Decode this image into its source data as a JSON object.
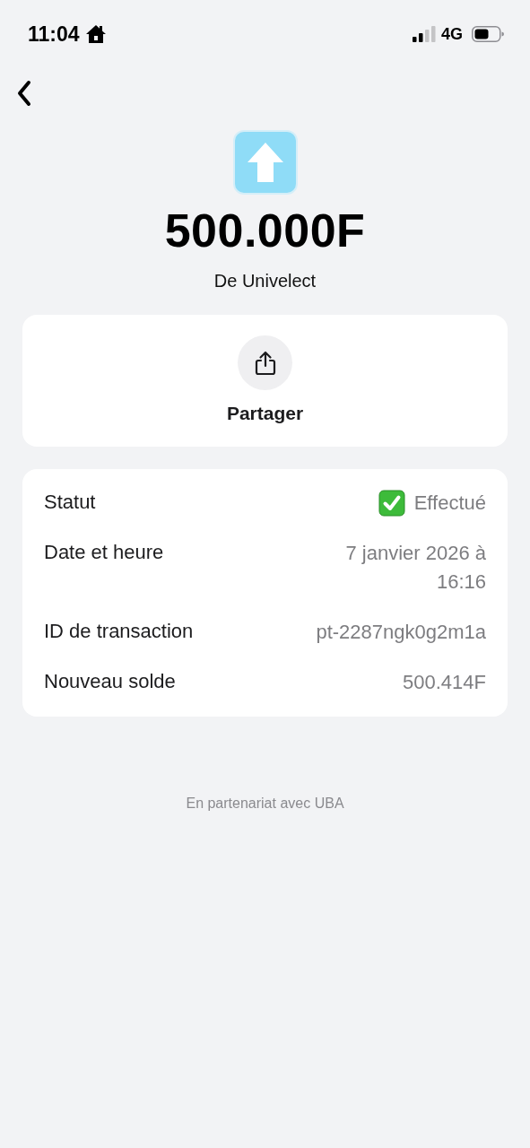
{
  "status_bar": {
    "time": "11:04",
    "network": "4G"
  },
  "amount": "500.000F",
  "counterparty": "De Univelect",
  "share": {
    "label": "Partager"
  },
  "details": [
    {
      "kind": "status",
      "label": "Statut",
      "value": "Effectué"
    },
    {
      "kind": "text",
      "label": "Date et heure",
      "value": "7 janvier 2026 à 16:16"
    },
    {
      "kind": "text",
      "label": "ID de transaction",
      "value": "pt-2287ngk0g2m1a"
    },
    {
      "kind": "text",
      "label": "Nouveau solde",
      "value": "500.414F"
    }
  ],
  "footer": "En partenariat avec UBA"
}
